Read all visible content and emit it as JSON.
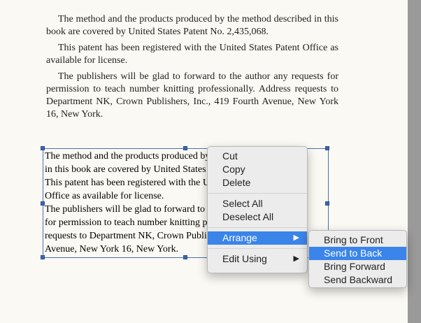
{
  "document": {
    "paragraphs": [
      "The method and the products produced by the method described in this book are covered by United States Patent No. 2,435,068.",
      "This patent has been registered with the United States Patent Office as available for license.",
      "The publishers will be glad to forward to the author any requests for permission to teach number knitting professionally. Address requests to Department NK, Crown Publishers, Inc., 419 Fourth Avenue, New York 16, New York."
    ]
  },
  "textbox": {
    "lines": [
      "The method and the products produced by the method described",
      "in this book are covered by United States Patent No. 2,435,068.",
      "This patent has been registered with the United States Patent",
      "Office as available for license.",
      "The publishers will be glad to forward to the author any requests",
      "for permission to teach number knitting professionally. Address",
      "requests to Department NK, Crown Publishers, Inc., 419 Fourth",
      "Avenue, New York 16, New York."
    ]
  },
  "context_menu": {
    "cut": "Cut",
    "copy": "Copy",
    "delete": "Delete",
    "select_all": "Select All",
    "deselect_all": "Deselect All",
    "arrange": "Arrange",
    "edit_using": "Edit Using"
  },
  "arrange_submenu": {
    "bring_to_front": "Bring to Front",
    "send_to_back": "Send to Back",
    "bring_forward": "Bring Forward",
    "send_backward": "Send Backward"
  },
  "icons": {
    "submenu_arrow": "chevron-right-icon"
  },
  "colors": {
    "selection": "#3a84ea",
    "handle": "#3b66b5"
  }
}
